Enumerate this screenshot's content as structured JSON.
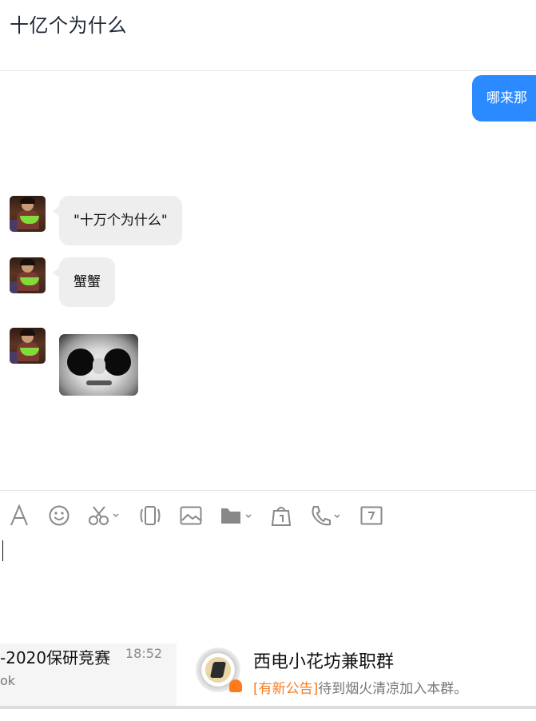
{
  "chat": {
    "title": "十亿个为什么",
    "outgoing": [
      "哪来那"
    ],
    "incoming": [
      {
        "type": "text",
        "text": "\"十万个为什么\""
      },
      {
        "type": "text",
        "text": "蟹蟹"
      },
      {
        "type": "image",
        "alt": "sticker"
      }
    ]
  },
  "toolbar": {
    "icons": [
      "font-icon",
      "emoji-icon",
      "screenshot-icon",
      "shake-icon",
      "image-icon",
      "folder-icon",
      "gift-icon",
      "phone-icon",
      "calendar-icon"
    ]
  },
  "conversation_list": {
    "left": {
      "name": "-2020保研竞赛",
      "time": "18:52",
      "preview": "ok"
    },
    "right": {
      "name": "西电小花坊兼职群",
      "notice_tag": "[有新公告]",
      "notice_text": "待到烟火清凉加入本群。"
    }
  },
  "colors": {
    "accent": "#2b8aff",
    "bubble_in": "#eeeeee",
    "notice_tag": "#f57c1f",
    "icon": "#888888"
  }
}
